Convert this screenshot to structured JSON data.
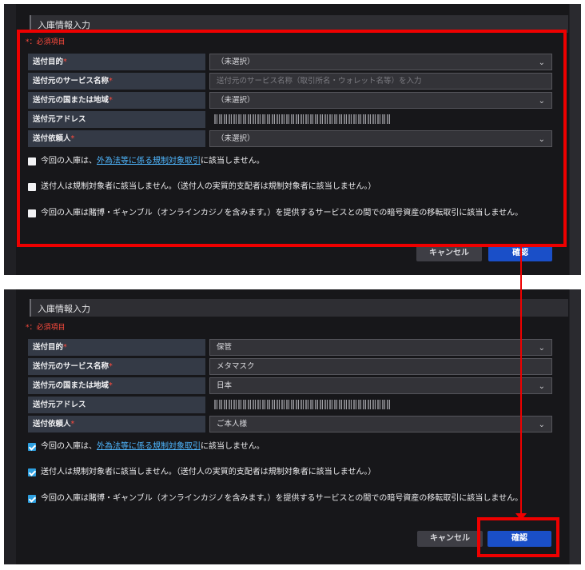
{
  "dialog_title": "入庫情報入力",
  "required_note": "*：必須項目",
  "fields": [
    {
      "label": "送付目的",
      "required": true
    },
    {
      "label": "送付元のサービス名称",
      "required": true
    },
    {
      "label": "送付元の国または地域",
      "required": true
    },
    {
      "label": "送付元アドレス",
      "required": false
    },
    {
      "label": "送付依頼人",
      "required": true
    }
  ],
  "required_mark": "*",
  "screen1": {
    "values": [
      "（未選択）",
      "",
      "（未選択）",
      "",
      "（未選択）"
    ],
    "service_placeholder": "送付元のサービス名称（取引所名・ウォレット名等）を入力"
  },
  "screen2": {
    "values": [
      "保管",
      "メタマスク",
      "日本",
      "",
      "ご本人様"
    ]
  },
  "checks": {
    "c1_pre": "今回の入庫は、",
    "c1_link": "外為法等に係る規制対象取引",
    "c1_post": "に該当しません。",
    "c2": "送付人は規制対象者に該当しません。（送付人の実質的支配者は規制対象者に該当しません。）",
    "c3": "今回の入庫は賭博・ギャンブル（オンラインカジノを含みます。）を提供するサービスとの間での暗号資産の移転取引に該当しません。"
  },
  "buttons": {
    "cancel": "キャンセル",
    "confirm": "確認"
  },
  "colors": {
    "highlight": "#ee0000",
    "confirm": "#1a4fc8",
    "required": "#ff4b3e",
    "link": "#4fb7ff",
    "checked": "#2ea0e0"
  }
}
